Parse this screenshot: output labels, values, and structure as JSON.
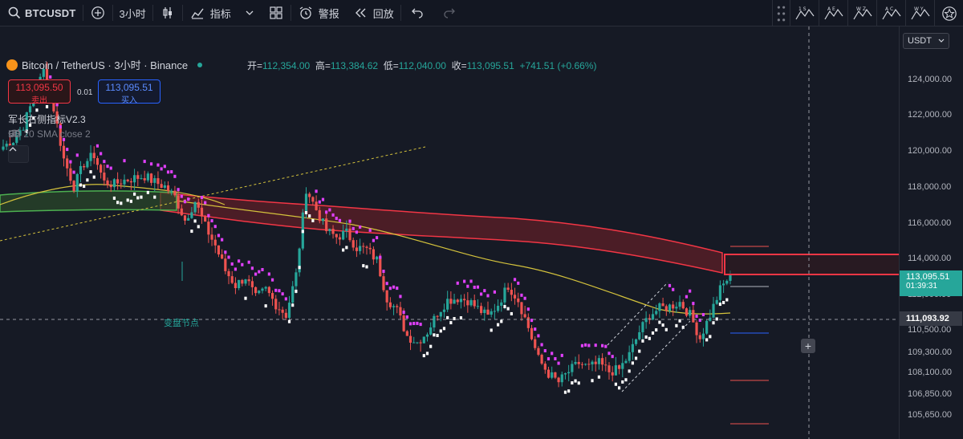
{
  "toolbar": {
    "symbol": "BTCUSDT",
    "interval": "3小时",
    "indicators": "指标",
    "alert": "警报",
    "replay": "回放",
    "right_icons": [
      "1 S",
      "A E",
      "W Z",
      "A C",
      "W Y"
    ]
  },
  "legend": {
    "title": "Bitcoin / TetherUS · 3小时 · Binance",
    "open_label": "开=",
    "open": "112,354.00",
    "high_label": "高=",
    "high": "113,384.62",
    "low_label": "低=",
    "low": "112,040.00",
    "close_label": "收=",
    "close": "113,095.51",
    "change": "+741.51 (+0.66%)"
  },
  "order": {
    "sell_price": "113,095.50",
    "sell_label": "卖出",
    "spread": "0.01",
    "buy_price": "113,095.51",
    "buy_label": "买入"
  },
  "indicators": {
    "name1": "军长右侧指标V2.3",
    "name2": "BB 20 SMA close 2"
  },
  "annotation": "变盘节点",
  "price_axis": {
    "currency": "USDT",
    "levels": [
      "124,000.00",
      "122,000.00",
      "120,000.00",
      "118,000.00",
      "116,000.00",
      "114,000.00",
      "112,000.00",
      "110,500.00",
      "109,300.00",
      "108,100.00",
      "106,850.00",
      "105,650.00"
    ],
    "current_price": "113,095.51",
    "countdown": "01:39:31",
    "crosshair_price": "111,093.92"
  },
  "colors": {
    "background": "#161a25",
    "up": "#26a69a",
    "down": "#ef5350",
    "magenta": "#e040fb",
    "band": "#f23645",
    "ma_yellow": "#d4c23c",
    "ma_green": "#4caf50"
  },
  "chart_data": {
    "type": "candlestick",
    "y_unit": "USDT",
    "ylim": [
      105300,
      124900
    ],
    "current_price": 113095.51,
    "resistance_zone": [
      113400,
      114450
    ],
    "crosshair_price": 111093.92,
    "close_path": [
      119200,
      119500,
      120200,
      121500,
      122800,
      121000,
      118600,
      117300,
      118400,
      118800,
      117500,
      117400,
      117600,
      117700,
      117800,
      117500,
      117300,
      116800,
      115700,
      116600,
      115400,
      114500,
      113300,
      112600,
      113000,
      112000,
      112400,
      111700,
      111200,
      113100,
      117200,
      116200,
      115200,
      114900,
      115100,
      114400,
      114300,
      113800,
      112000,
      111400,
      110200,
      109900,
      110400,
      111300,
      111900,
      112000,
      111900,
      111500,
      111100,
      111700,
      112600,
      111900,
      110600,
      109100,
      108400,
      108000,
      108500,
      108900,
      108700,
      108900,
      108500,
      108600,
      109300,
      110400,
      111200,
      111500,
      111600,
      111800,
      111200,
      110100,
      111200,
      112400,
      113100
    ]
  }
}
